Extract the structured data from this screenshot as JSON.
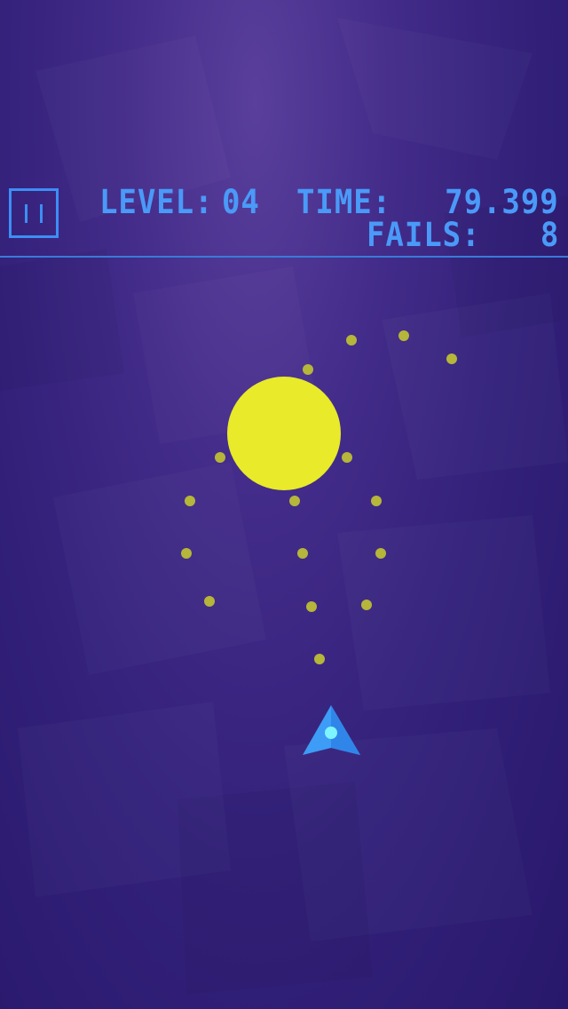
{
  "hud": {
    "level_label": "LEVEL:",
    "level_value": "04",
    "time_label": "TIME:",
    "time_value": "79.399",
    "fails_label": "FAILS:",
    "fails_value": "8"
  },
  "pause_icon": "pause-icon",
  "colors": {
    "hud_blue": "#4a9af8",
    "sun_yellow": "#e8ea2a",
    "dot_yellow": "#b5b63a",
    "ship_blue": "#3d9cf6",
    "ship_core": "#7ef4ff",
    "background_top": "#5a3f9c",
    "background_bottom": "#28186b"
  },
  "scene": {
    "sun": "yellow-sun",
    "player": "player-ship",
    "orbit_dots_count": 18
  }
}
